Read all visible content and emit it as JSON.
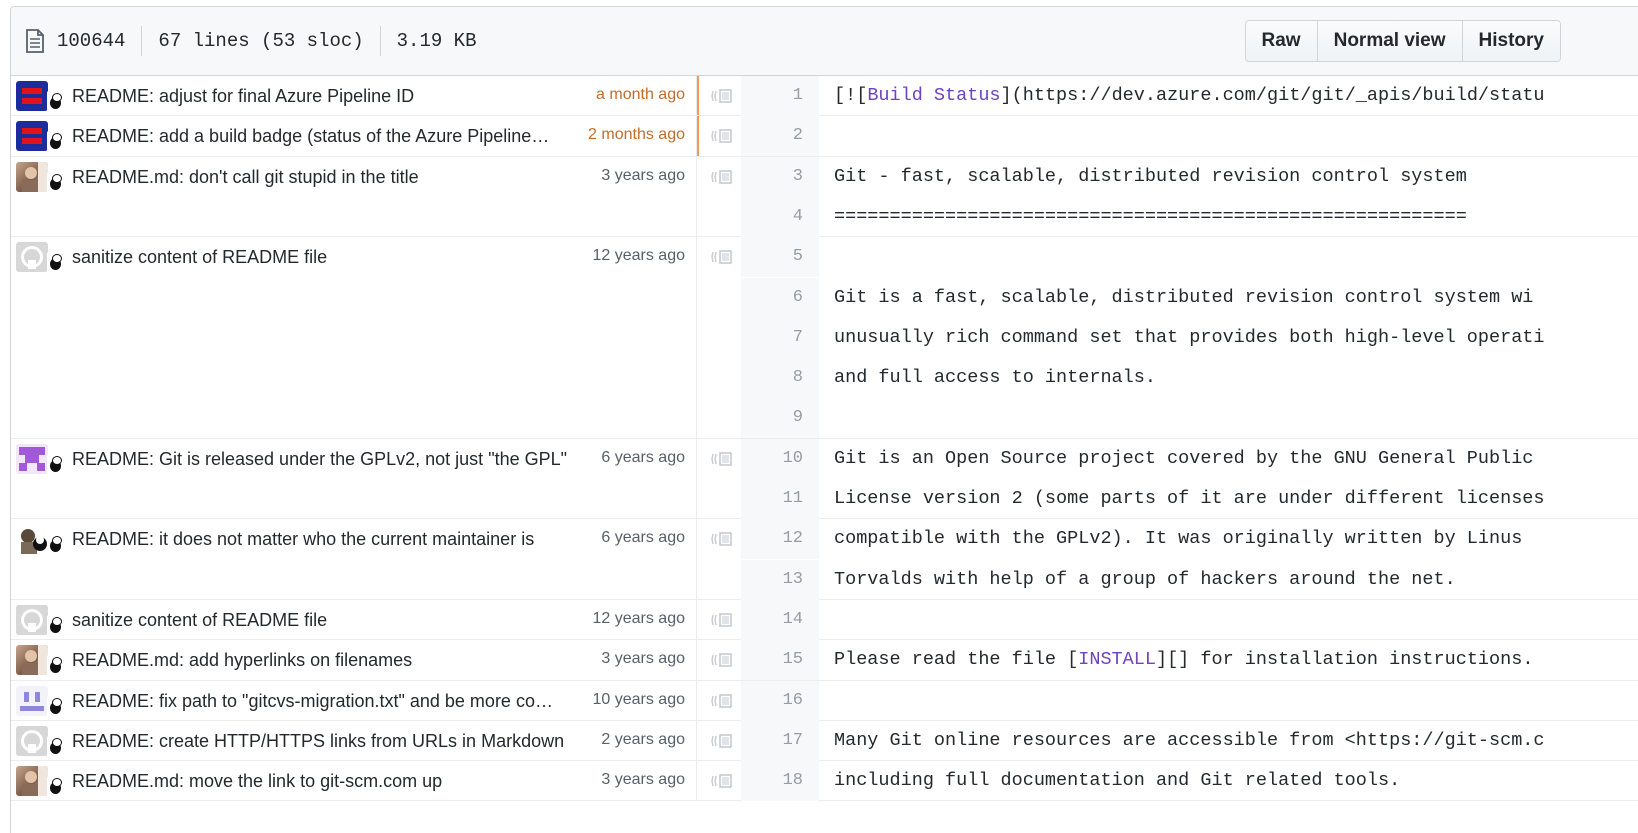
{
  "file_header": {
    "mode": "100644",
    "lines": "67 lines (53 sloc)",
    "size": "3.19 KB",
    "buttons": {
      "raw": "Raw",
      "normal_view": "Normal view",
      "history": "History"
    }
  },
  "colors": {
    "recent_heat": "#f29a55",
    "orange_age": "#c26d2b",
    "link_purple": "#6f42c1"
  },
  "commits": [
    {
      "message": "README: adjust for final Azure Pipeline ID",
      "age": "a month ago",
      "avatar": "azure-avatar"
    },
    {
      "message": "README: add a build badge (status of the Azure Pipeline…",
      "age": "2 months ago",
      "avatar": "azure-avatar"
    },
    {
      "message": "README.md: don't call git stupid in the title",
      "age": "3 years ago",
      "avatar": "photo-avatar"
    },
    {
      "message": "sanitize content of README file",
      "age": "12 years ago",
      "avatar": "octocat-avatar"
    },
    {
      "message": "README: Git is released under the GPLv2, not just \"the GPL\"",
      "age": "6 years ago",
      "avatar": "purple-identicon-avatar"
    },
    {
      "message": "README: it does not matter who the current maintainer is",
      "age": "6 years ago",
      "avatar": "panda-avatar"
    },
    {
      "message": "sanitize content of README file",
      "age": "12 years ago",
      "avatar": "octocat-avatar"
    },
    {
      "message": "README.md: add hyperlinks on filenames",
      "age": "3 years ago",
      "avatar": "photo-avatar"
    },
    {
      "message": "README: fix path to \"gitcvs-migration.txt\" and be more co…",
      "age": "10 years ago",
      "avatar": "purple-face-avatar"
    },
    {
      "message": "README: create HTTP/HTTPS links from URLs in Markdown",
      "age": "2 years ago",
      "avatar": "octocat-avatar"
    },
    {
      "message": "README.md: move the link to git-scm.com up",
      "age": "3 years ago",
      "avatar": "photo-avatar"
    }
  ],
  "lines": [
    {
      "n": "1",
      "pre": "[![",
      "link": "Build Status",
      "post": "](https://dev.azure.com/git/git/_apis/build/statu"
    },
    {
      "n": "2",
      "text": ""
    },
    {
      "n": "3",
      "text": "Git - fast, scalable, distributed revision control system"
    },
    {
      "n": "4",
      "text": "========================================================="
    },
    {
      "n": "5",
      "text": ""
    },
    {
      "n": "6",
      "text": "Git is a fast, scalable, distributed revision control system wi"
    },
    {
      "n": "7",
      "text": "unusually rich command set that provides both high-level operati"
    },
    {
      "n": "8",
      "text": "and full access to internals."
    },
    {
      "n": "9",
      "text": ""
    },
    {
      "n": "10",
      "text": "Git is an Open Source project covered by the GNU General Public"
    },
    {
      "n": "11",
      "text": "License version 2 (some parts of it are under different licenses"
    },
    {
      "n": "12",
      "text": "compatible with the GPLv2). It was originally written by Linus"
    },
    {
      "n": "13",
      "text": "Torvalds with help of a group of hackers around the net."
    },
    {
      "n": "14",
      "text": ""
    },
    {
      "n": "15",
      "pre": "Please read the file [",
      "link": "INSTALL",
      "post": "][] for installation instructions."
    },
    {
      "n": "16",
      "text": ""
    },
    {
      "n": "17",
      "text": "Many Git online resources are accessible from <https://git-scm.c"
    },
    {
      "n": "18",
      "text": "including full documentation and Git related tools."
    }
  ]
}
